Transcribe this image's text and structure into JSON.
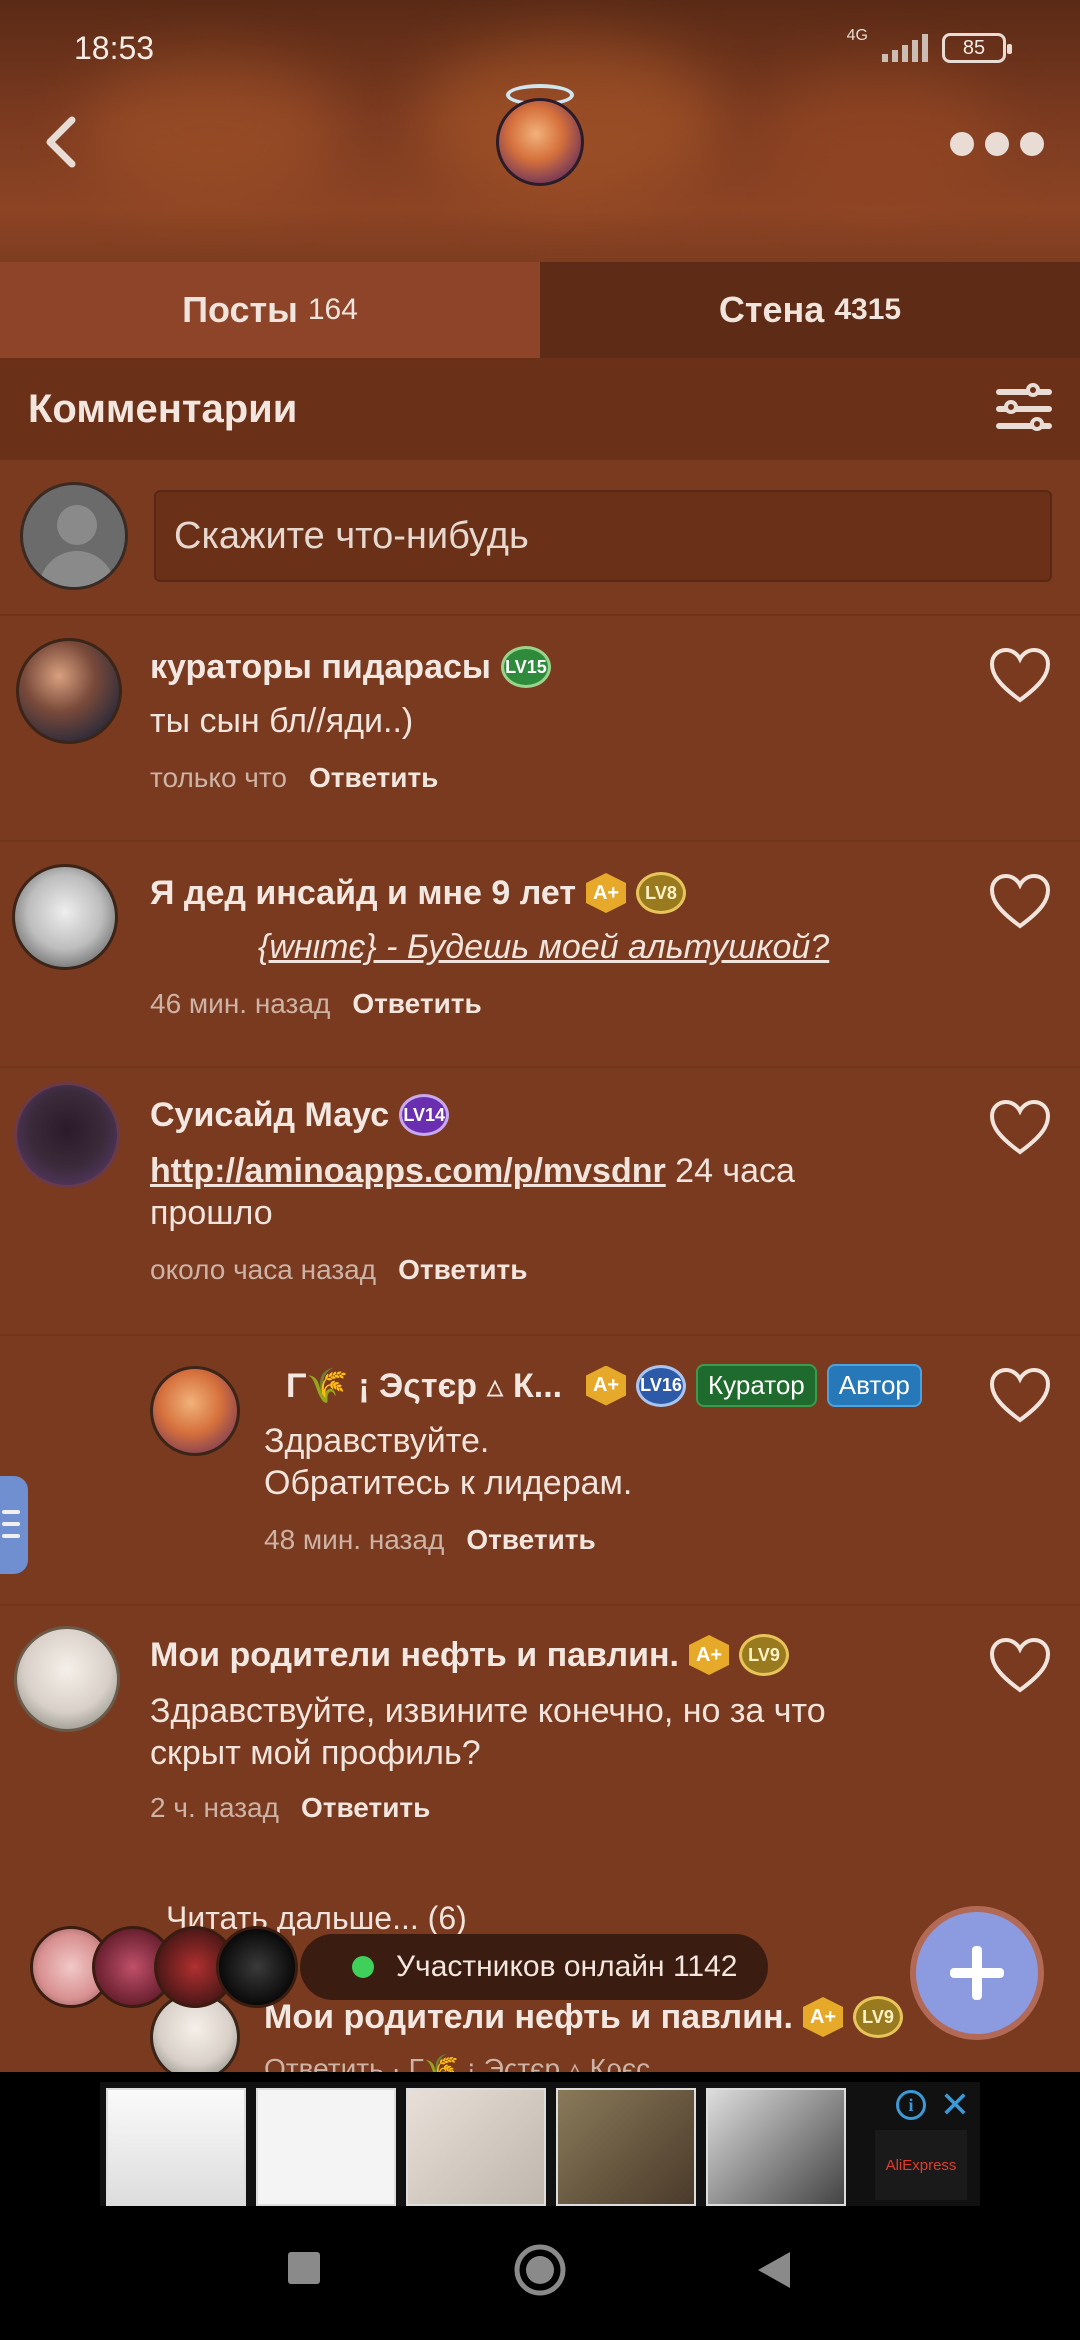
{
  "status": {
    "time": "18:53",
    "network": "4G",
    "battery": "85",
    "signal_bars": 5
  },
  "header": {
    "back_label": "back",
    "more_label": "more options"
  },
  "tabs": [
    {
      "label": "Посты",
      "count": "164"
    },
    {
      "label": "Стена",
      "count": "4315"
    }
  ],
  "section": {
    "title": "Комментарии"
  },
  "compose": {
    "placeholder": "Скажите что-нибудь"
  },
  "comments": [
    {
      "author": "кураторы пидарасы",
      "level": "LV15",
      "text": "ты сын бл//яди..)",
      "time": "только что",
      "reply": "Ответить"
    },
    {
      "author": "Я дед инсайд и мне 9 лет",
      "medal": "A+",
      "level": "LV8",
      "text": "{wнιтє} - Будешь моей альтушкой?",
      "time": "46 мин. назад",
      "reply": "Ответить"
    },
    {
      "author": "Суисайд Маус",
      "level": "LV14",
      "link": "http://aminoapps.com/p/mvsdnr",
      "text": "24 часа",
      "text2": "прошло",
      "time": "около часа назад",
      "reply": "Ответить"
    },
    {
      "author": "Γ🌾 ¡ Эςтєр ▵ К...",
      "medal": "A+",
      "level": "LV16",
      "tag1": "Куратор",
      "tag2": "Автор",
      "text": "Здравствуйте.",
      "text2": "Обратитесь к лидерам.",
      "time": "48 мин. назад",
      "reply": "Ответить"
    },
    {
      "author": "Мои родители нефть и павлин.",
      "medal": "A+",
      "level": "LV9",
      "text": "Здравствуйте, извините конечно, но за что",
      "text2": "скрыт мой профиль?",
      "time": "2 ч. назад",
      "reply": "Ответить"
    }
  ],
  "read_more": "Читать дальше... (6)",
  "online": {
    "label": "Участников онлайн 1142"
  },
  "next_comment": {
    "author": "Мои родители нефть и павлин.",
    "medal": "A+",
    "level": "LV9",
    "preview": "Ответить · Γ🌾 ¡ Эςтєр ▵ Кρєс..."
  },
  "ad": {
    "brand": "AliExpress",
    "info": "i",
    "close": "✕"
  }
}
